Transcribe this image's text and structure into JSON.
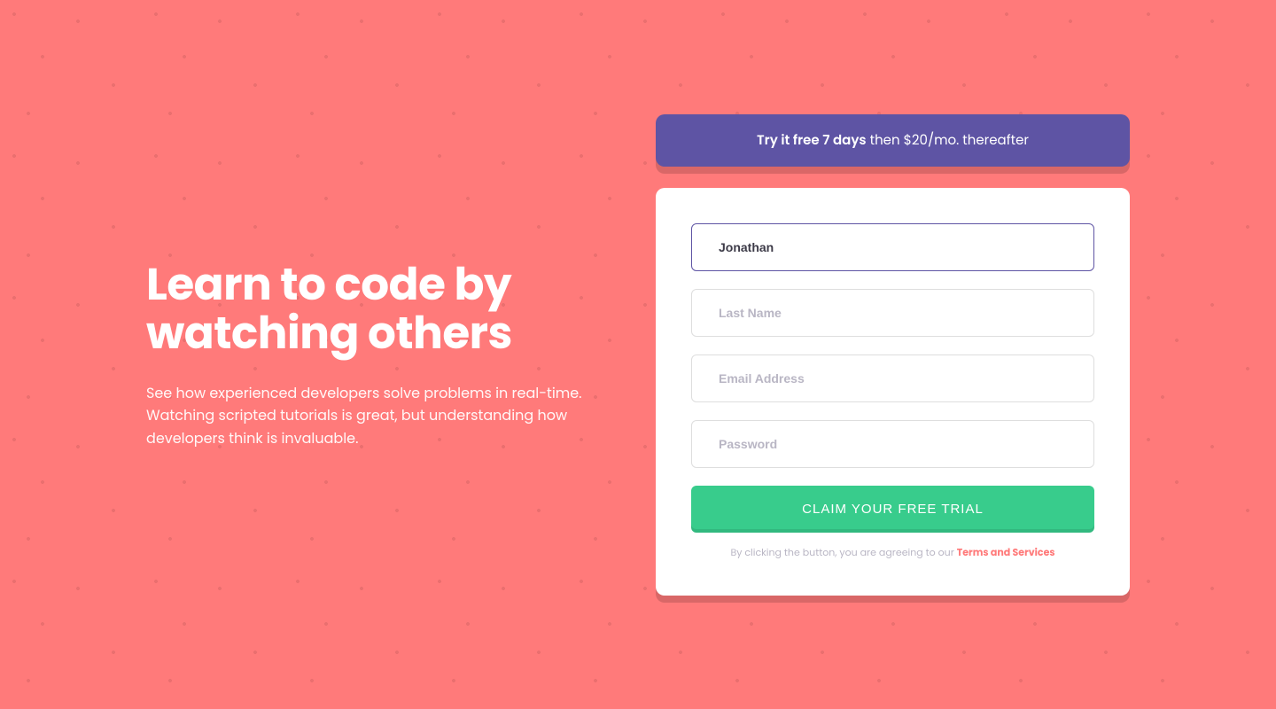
{
  "hero": {
    "heading": "Learn to code by watching others",
    "subtext": "See how experienced developers solve problems in real-time. Watching scripted tutorials is great, but understanding how developers think is invaluable."
  },
  "banner": {
    "bold": "Try it free 7 days",
    "rest": " then $20/mo. thereafter"
  },
  "form": {
    "first_name_value": "Jonathan ",
    "last_name_placeholder": "Last Name",
    "email_placeholder": "Email Address",
    "password_placeholder": "Password",
    "submit_label": "CLAIM YOUR FREE TRIAL"
  },
  "terms": {
    "prefix": "By clicking the button, you are agreeing to our ",
    "link": "Terms and Services"
  }
}
